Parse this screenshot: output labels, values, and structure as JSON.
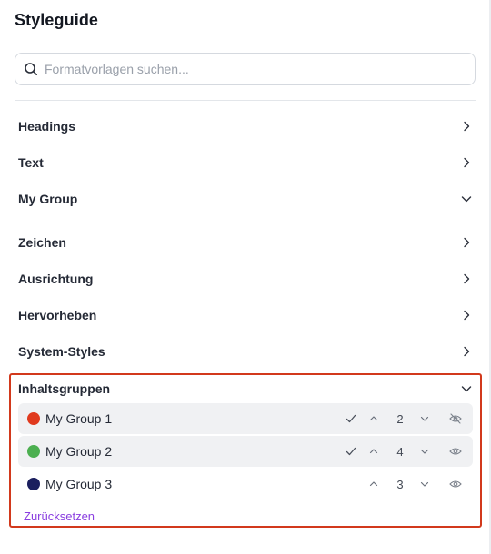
{
  "header": {
    "title": "Styleguide"
  },
  "search": {
    "placeholder": "Formatvorlagen suchen...",
    "value": ""
  },
  "sections": [
    {
      "label": "Headings",
      "state": "collapsed"
    },
    {
      "label": "Text",
      "state": "collapsed"
    },
    {
      "label": "My Group",
      "state": "expanded"
    },
    {
      "label": "Zeichen",
      "state": "collapsed"
    },
    {
      "label": "Ausrichtung",
      "state": "collapsed"
    },
    {
      "label": "Hervorheben",
      "state": "collapsed"
    },
    {
      "label": "System-Styles",
      "state": "collapsed"
    }
  ],
  "content_groups": {
    "label": "Inhaltsgruppen",
    "state": "expanded",
    "items": [
      {
        "name": "My Group 1",
        "color": "#e03a1e",
        "order": "2",
        "checked": true,
        "visibility": "hidden",
        "highlighted": true
      },
      {
        "name": "My Group 2",
        "color": "#4caf50",
        "order": "4",
        "checked": true,
        "visibility": "visible",
        "highlighted": true
      },
      {
        "name": "My Group 3",
        "color": "#1b1f5e",
        "order": "3",
        "checked": false,
        "visibility": "visible",
        "highlighted": false
      }
    ],
    "reset_label": "Zurücksetzen"
  },
  "colors": {
    "accent": "#8a3ee0",
    "highlight_border": "#d2391c"
  },
  "icons": [
    "search-icon",
    "chevron-right-icon",
    "chevron-down-icon",
    "check-icon",
    "chevron-up-icon",
    "eye-icon",
    "eye-off-icon"
  ]
}
